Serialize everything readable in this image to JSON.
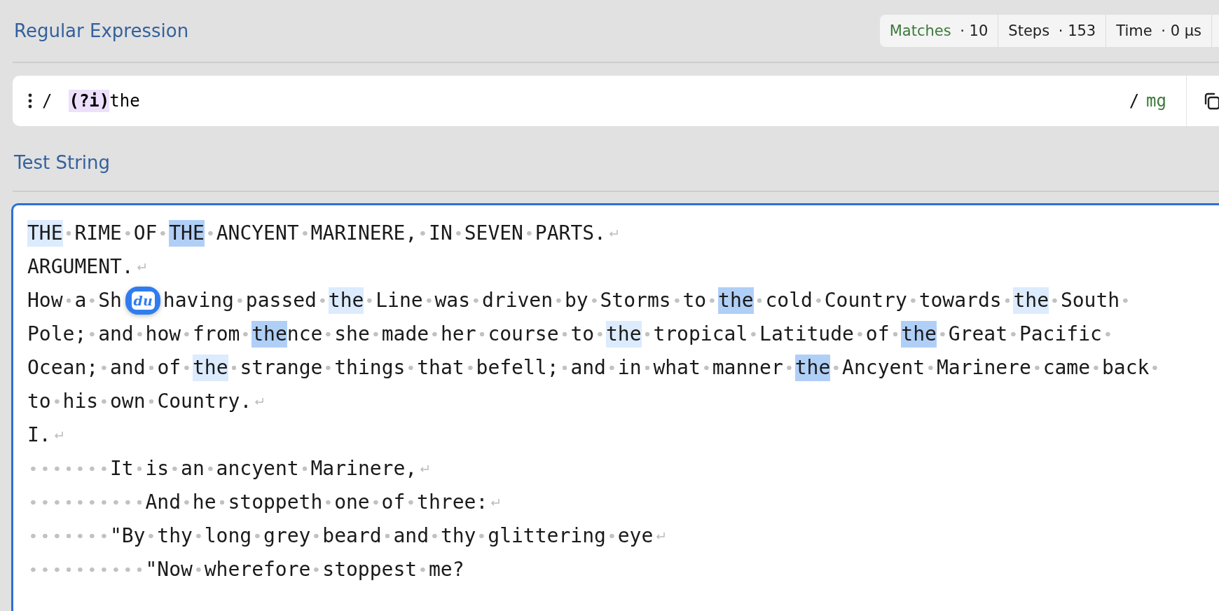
{
  "regex_section": {
    "title": "Regular Expression",
    "stats": [
      {
        "label": "Matches",
        "value": "10",
        "kind": "matches"
      },
      {
        "label": "Steps",
        "value": "153",
        "kind": "plain"
      },
      {
        "label": "Time",
        "value": "0 µs",
        "kind": "plain"
      }
    ],
    "separator": "·"
  },
  "regex_field": {
    "open_delimiter": "/",
    "tokens": [
      {
        "text": "(?i)",
        "kind": "group"
      },
      {
        "text": "the",
        "kind": "literal"
      }
    ],
    "close_delimiter": "/",
    "flags": "mg"
  },
  "test_section": {
    "title": "Test String"
  },
  "test_string": {
    "rows": [
      {
        "eol": true,
        "segments": [
          {
            "kind": "match",
            "alt": false,
            "text": "THE"
          },
          {
            "kind": "text",
            "text": " RIME OF "
          },
          {
            "kind": "match",
            "alt": true,
            "text": "THE"
          },
          {
            "kind": "text",
            "text": " ANCYENT MARINERE, IN SEVEN PARTS."
          }
        ]
      },
      {
        "eol": true,
        "segments": [
          {
            "kind": "text",
            "text": "ARGUMENT."
          }
        ]
      },
      {
        "eol": false,
        "segments": [
          {
            "kind": "text",
            "text": "How a Sh"
          },
          {
            "kind": "badge",
            "text": "du"
          },
          {
            "kind": "text",
            "text": "having passed "
          },
          {
            "kind": "match",
            "alt": false,
            "text": "the"
          },
          {
            "kind": "text",
            "text": " Line was driven by Storms to "
          },
          {
            "kind": "match",
            "alt": true,
            "text": "the"
          },
          {
            "kind": "text",
            "text": " cold Country towards "
          },
          {
            "kind": "match",
            "alt": false,
            "text": "the"
          },
          {
            "kind": "text",
            "text": " South "
          }
        ]
      },
      {
        "eol": false,
        "segments": [
          {
            "kind": "text",
            "text": "Pole; and how from "
          },
          {
            "kind": "match",
            "alt": true,
            "text": "the"
          },
          {
            "kind": "text",
            "text": "nce she made her course to "
          },
          {
            "kind": "match",
            "alt": false,
            "text": "the"
          },
          {
            "kind": "text",
            "text": " tropical Latitude of "
          },
          {
            "kind": "match",
            "alt": true,
            "text": "the"
          },
          {
            "kind": "text",
            "text": " Great Pacific "
          }
        ]
      },
      {
        "eol": false,
        "segments": [
          {
            "kind": "text",
            "text": "Ocean; and of "
          },
          {
            "kind": "match",
            "alt": false,
            "text": "the"
          },
          {
            "kind": "text",
            "text": " strange things that befell; and in what manner "
          },
          {
            "kind": "match",
            "alt": true,
            "text": "the"
          },
          {
            "kind": "text",
            "text": " Ancyent Marinere came back "
          }
        ]
      },
      {
        "eol": true,
        "segments": [
          {
            "kind": "text",
            "text": "to his own Country."
          }
        ]
      },
      {
        "eol": true,
        "segments": [
          {
            "kind": "text",
            "text": "I."
          }
        ]
      },
      {
        "eol": true,
        "segments": [
          {
            "kind": "text",
            "text": "       It is an ancyent Marinere,"
          }
        ]
      },
      {
        "eol": true,
        "segments": [
          {
            "kind": "text",
            "text": "          And he stoppeth one of three:"
          }
        ]
      },
      {
        "eol": true,
        "segments": [
          {
            "kind": "text",
            "text": "       \"By thy long grey beard and thy glittering eye"
          }
        ]
      },
      {
        "eol": false,
        "segments": [
          {
            "kind": "text",
            "text": "          \"Now wherefore stoppest me?"
          }
        ]
      }
    ]
  }
}
